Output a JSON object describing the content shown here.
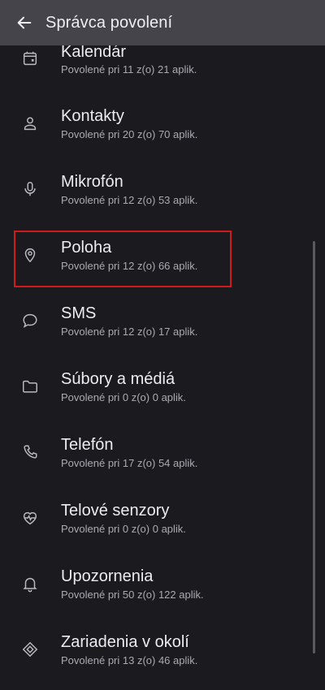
{
  "appbar": {
    "title": "Správca povolení"
  },
  "permissions": [
    {
      "title": "Kalendár",
      "subtitle": "Povolené pri 11 z(o) 21 aplik.",
      "icon": "calendar-icon"
    },
    {
      "title": "Kontakty",
      "subtitle": "Povolené pri 20 z(o) 70 aplik.",
      "icon": "person-icon"
    },
    {
      "title": "Mikrofón",
      "subtitle": "Povolené pri 12 z(o) 53 aplik.",
      "icon": "microphone-icon"
    },
    {
      "title": "Poloha",
      "subtitle": "Povolené pri 12 z(o) 66 aplik.",
      "icon": "location-pin-icon"
    },
    {
      "title": "SMS",
      "subtitle": "Povolené pri 12 z(o) 17 aplik.",
      "icon": "chat-bubble-icon"
    },
    {
      "title": "Súbory a médiá",
      "subtitle": "Povolené pri 0 z(o) 0 aplik.",
      "icon": "folder-icon"
    },
    {
      "title": "Telefón",
      "subtitle": "Povolené pri 17 z(o) 54 aplik.",
      "icon": "phone-icon"
    },
    {
      "title": "Telové senzory",
      "subtitle": "Povolené pri 0 z(o) 0 aplik.",
      "icon": "heart-pulse-icon"
    },
    {
      "title": "Upozornenia",
      "subtitle": "Povolené pri 50 z(o) 122 aplik.",
      "icon": "bell-icon"
    },
    {
      "title": "Zariadenia v okolí",
      "subtitle": "Povolené pri 13 z(o) 46 aplik.",
      "icon": "nearby-devices-icon"
    }
  ],
  "colors": {
    "background": "#1b1b1f",
    "appbar": "#44444a",
    "highlight": "#d31a1a"
  }
}
